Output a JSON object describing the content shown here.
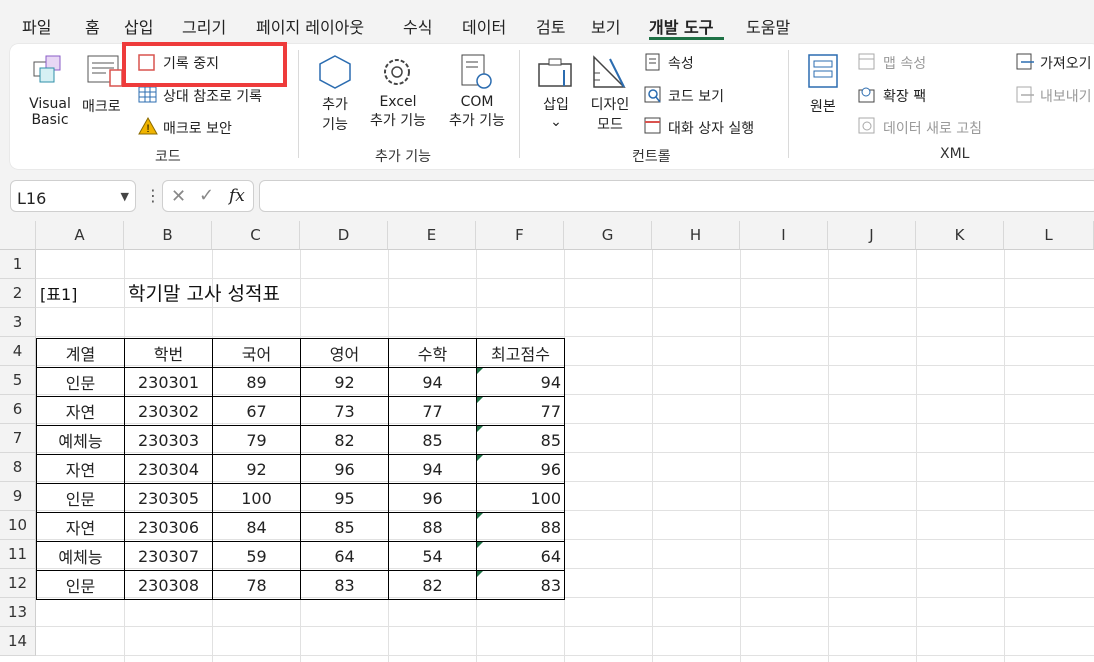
{
  "menu": [
    "파일",
    "홈",
    "삽입",
    "그리기",
    "페이지 레이아웃",
    "수식",
    "데이터",
    "검토",
    "보기",
    "개발 도구",
    "도움말"
  ],
  "ribbon": {
    "visual_basic": [
      "Visual",
      "Basic"
    ],
    "macro": "매크로",
    "record_stop": "기록 중지",
    "relative_ref": "상대 참조로 기록",
    "macro_security": "매크로 보안",
    "group_code": "코드",
    "addins": [
      "추가",
      "기능"
    ],
    "excel_addins": [
      "Excel",
      "추가 기능"
    ],
    "com_addins": [
      "COM",
      "추가 기능"
    ],
    "group_addins": "추가 기능",
    "insert": "삽입",
    "design_mode": [
      "디자인",
      "모드"
    ],
    "properties": "속성",
    "view_code": "코드 보기",
    "run_dialog": "대화 상자 실행",
    "group_controls": "컨트롤",
    "source": "원본",
    "map_properties": "맵 속성",
    "expansion_packs": "확장 팩",
    "refresh_data": "데이터 새로 고침",
    "import": "가져오기",
    "export": "내보내기",
    "group_xml": "XML"
  },
  "namebox": "L16",
  "fx": "fx",
  "columns": [
    "A",
    "B",
    "C",
    "D",
    "E",
    "F",
    "G",
    "H",
    "I",
    "J",
    "K",
    "L"
  ],
  "rows": [
    "1",
    "2",
    "3",
    "4",
    "5",
    "6",
    "7",
    "8",
    "9",
    "10",
    "11",
    "12",
    "13",
    "14"
  ],
  "sheet": {
    "label": "[표1]",
    "title": "학기말 고사 성적표",
    "headers": [
      "계열",
      "학번",
      "국어",
      "영어",
      "수학",
      "최고점수"
    ],
    "data": [
      [
        "인문",
        "230301",
        "89",
        "92",
        "94",
        "94"
      ],
      [
        "자연",
        "230302",
        "67",
        "73",
        "77",
        "77"
      ],
      [
        "예체능",
        "230303",
        "79",
        "82",
        "85",
        "85"
      ],
      [
        "자연",
        "230304",
        "92",
        "96",
        "94",
        "96"
      ],
      [
        "인문",
        "230305",
        "100",
        "95",
        "96",
        "100"
      ],
      [
        "자연",
        "230306",
        "84",
        "85",
        "88",
        "88"
      ],
      [
        "예체능",
        "230307",
        "59",
        "64",
        "54",
        "64"
      ],
      [
        "인문",
        "230308",
        "78",
        "83",
        "82",
        "83"
      ]
    ]
  }
}
